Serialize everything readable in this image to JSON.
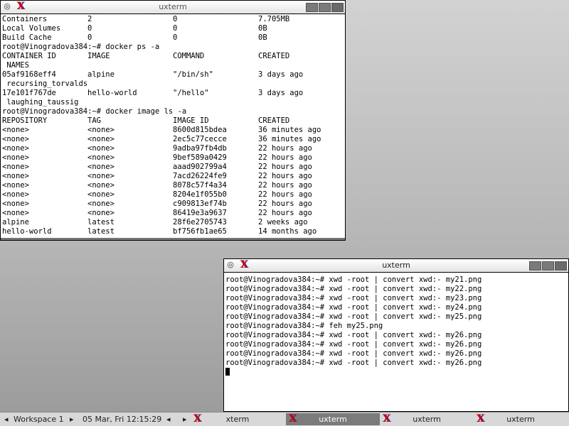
{
  "window1": {
    "title": "uxterm",
    "lines": [
      [
        "Containers",
        "2",
        "0",
        "7.705MB"
      ],
      [
        "Local Volumes",
        "0",
        "0",
        "0B"
      ],
      [
        "Build Cache",
        "0",
        "0",
        "0B"
      ],
      [
        "root@Vinogradova384:~# docker ps -a"
      ],
      [
        "CONTAINER ID",
        "IMAGE",
        "COMMAND",
        "CREATED"
      ],
      [
        " NAMES"
      ],
      [
        "05af9168eff4",
        "alpine",
        "\"/bin/sh\"",
        "3 days ago"
      ],
      [
        " recursing_torvalds"
      ],
      [
        "17e101f767de",
        "hello-world",
        "\"/hello\"",
        "3 days ago"
      ],
      [
        " laughing_taussig"
      ],
      [
        "root@Vinogradova384:~# docker image ls -a"
      ],
      [
        "REPOSITORY",
        "TAG",
        "IMAGE ID",
        "CREATED"
      ],
      [
        "<none>",
        "<none>",
        "8600d815bdea",
        "36 minutes ago"
      ],
      [
        "<none>",
        "<none>",
        "2ec5c77cecce",
        "36 minutes ago"
      ],
      [
        "<none>",
        "<none>",
        "9adba97fb4db",
        "22 hours ago"
      ],
      [
        "<none>",
        "<none>",
        "9bef589a0429",
        "22 hours ago"
      ],
      [
        "<none>",
        "<none>",
        "aaad902799a4",
        "22 hours ago"
      ],
      [
        "<none>",
        "<none>",
        "7acd26224fe9",
        "22 hours ago"
      ],
      [
        "<none>",
        "<none>",
        "8078c57f4a34",
        "22 hours ago"
      ],
      [
        "<none>",
        "<none>",
        "8204e1f055b0",
        "22 hours ago"
      ],
      [
        "<none>",
        "<none>",
        "c909813ef74b",
        "22 hours ago"
      ],
      [
        "<none>",
        "<none>",
        "86419e3a9637",
        "22 hours ago"
      ],
      [
        "alpine",
        "latest",
        "28f6e2705743",
        "2 weeks ago"
      ],
      [
        "hello-world",
        "latest",
        "bf756fb1ae65",
        "14 months ago"
      ]
    ]
  },
  "window2": {
    "title": "uxterm",
    "lines": [
      "root@Vinogradova384:~# xwd -root | convert xwd:- my21.png",
      "root@Vinogradova384:~# xwd -root | convert xwd:- my22.png",
      "root@Vinogradova384:~# xwd -root | convert xwd:- my23.png",
      "root@Vinogradova384:~# xwd -root | convert xwd:- my24.png",
      "root@Vinogradova384:~# xwd -root | convert xwd:- my25.png",
      "root@Vinogradova384:~# feh my25.png",
      "root@Vinogradova384:~# xwd -root | convert xwd:- my26.png",
      "root@Vinogradova384:~# xwd -root | convert xwd:- my26.png",
      "root@Vinogradova384:~# xwd -root | convert xwd:- my26.png",
      "root@Vinogradova384:~# xwd -root | convert xwd:- my26.png"
    ]
  },
  "taskbar": {
    "workspace": "Workspace 1",
    "clock": "05 Mar, Fri 12:15:29",
    "tasks": [
      {
        "label": "xterm",
        "active": false
      },
      {
        "label": "uxterm",
        "active": true
      },
      {
        "label": "uxterm",
        "active": false
      },
      {
        "label": "uxterm",
        "active": false
      }
    ]
  }
}
